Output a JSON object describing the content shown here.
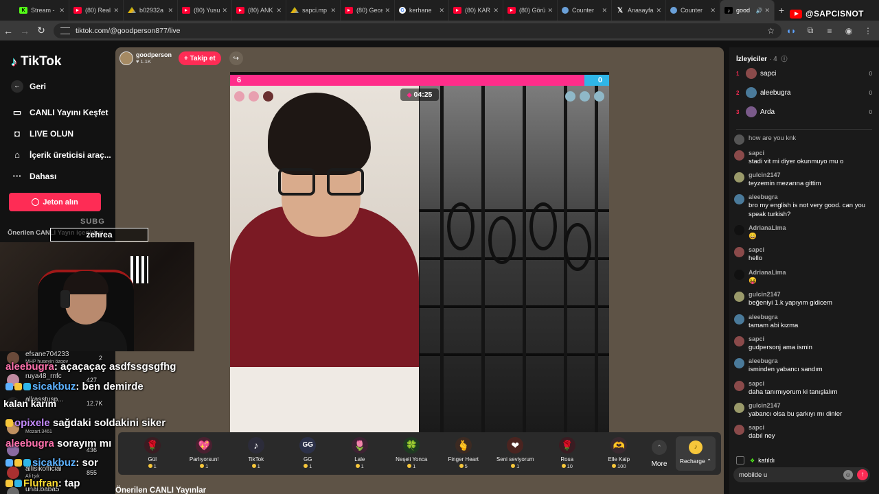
{
  "browser": {
    "tabs": [
      {
        "label": "Stream -",
        "icon": "kick"
      },
      {
        "label": "(80) Real",
        "icon": "youtube"
      },
      {
        "label": "b02932a",
        "icon": "drive"
      },
      {
        "label": "(80) Yusu",
        "icon": "youtube"
      },
      {
        "label": "(80) ANK",
        "icon": "youtube"
      },
      {
        "label": "sapci.mp",
        "icon": "drive"
      },
      {
        "label": "(80) Gece",
        "icon": "youtube"
      },
      {
        "label": "kerhane",
        "icon": "google"
      },
      {
        "label": "(80) KAR",
        "icon": "youtube"
      },
      {
        "label": "(80) Görü",
        "icon": "youtube"
      },
      {
        "label": "Counter",
        "icon": "counter"
      },
      {
        "label": "Anasayfa",
        "icon": "x"
      },
      {
        "label": "Counter",
        "icon": "counter"
      },
      {
        "label": "good",
        "icon": "tiktok",
        "active": true
      }
    ],
    "url": "tiktok.com/@goodperson877/live"
  },
  "watermark": "@SAPCISNOT",
  "sidebar": {
    "logo": "TikTok",
    "back": "Geri",
    "discover": "CANLI Yayını Keşfet",
    "go_live": "LIVE OLUN",
    "creator_tools": "İçerik üreticisi araç...",
    "more": "Dahası",
    "coins": "Jeton alın",
    "suggested": "Önerilen CANLI Yayın içerikleri"
  },
  "stream": {
    "host_name": "goodperson",
    "host_likes": "1.1K",
    "follow_label": "+ Takip et",
    "score_left": "6",
    "score_right": "0",
    "timer": "04:25",
    "gifts": [
      {
        "name": "Gül",
        "price": "1",
        "icon": "🌹",
        "color": "#3a1c22"
      },
      {
        "name": "Parlıyorsun!",
        "price": "1",
        "icon": "💖",
        "color": "#4a2030"
      },
      {
        "name": "TikTok",
        "price": "1",
        "icon": "♪",
        "color": "#2c2c3a"
      },
      {
        "name": "GG",
        "price": "1",
        "icon": "GG",
        "color": "#2c3148"
      },
      {
        "name": "Lale",
        "price": "1",
        "icon": "🌷",
        "color": "#3e2233"
      },
      {
        "name": "Neşeli Yonca",
        "price": "1",
        "icon": "🍀",
        "color": "#1f3a22"
      },
      {
        "name": "Finger Heart",
        "price": "5",
        "icon": "🫰",
        "color": "#3c2a22"
      },
      {
        "name": "Seni seviyorum",
        "price": "1",
        "icon": "❤",
        "color": "#4a2420"
      },
      {
        "name": "Rosa",
        "price": "10",
        "icon": "🌹",
        "color": "#3a1c22"
      },
      {
        "name": "Elle Kalp",
        "price": "100",
        "icon": "🫶",
        "color": "#3a2a30"
      }
    ],
    "more_label": "More",
    "recharge_label": "Recharge"
  },
  "chat": {
    "viewers_label": "İzleyiciler",
    "viewers_count": "· 4",
    "viewers": [
      {
        "rank": "1",
        "name": "sapci",
        "score": "0",
        "color": "#8a4a4a"
      },
      {
        "rank": "2",
        "name": "aleebugra",
        "score": "0",
        "color": "#4a7a9a"
      },
      {
        "rank": "3",
        "name": "Arda",
        "score": "0",
        "color": "#7a5a8a"
      }
    ],
    "messages": [
      {
        "user": "",
        "text": "how are you knk",
        "color": "#555"
      },
      {
        "user": "sapci",
        "text": "stadi vit mi diyer okunmuyo mu o",
        "color": "#8a4a4a"
      },
      {
        "user": "gulcin2147",
        "text": "teyzemin mezarına gittim",
        "color": "#9a9a6a"
      },
      {
        "user": "aleebugra",
        "text": "bro my english is not very good. can you speak turkish?",
        "color": "#4a7a9a"
      },
      {
        "user": "AdrianaLima",
        "text": "😄",
        "color": "#111"
      },
      {
        "user": "sapci",
        "text": "hello",
        "color": "#8a4a4a"
      },
      {
        "user": "AdrianaLima",
        "text": "😝",
        "color": "#111"
      },
      {
        "user": "gulcin2147",
        "text": "beğeniyi 1.k yapıyım gidicem",
        "color": "#9a9a6a"
      },
      {
        "user": "aleebugra",
        "text": "tamam abi kızma",
        "color": "#4a7a9a"
      },
      {
        "user": "sapci",
        "text": "gudpersonj ama ismin",
        "color": "#8a4a4a"
      },
      {
        "user": "aleebugra",
        "text": "isminden yabancı sandım",
        "color": "#4a7a9a"
      },
      {
        "user": "sapci",
        "text": "daha tanımıyorum ki tanışlalım",
        "color": "#8a4a4a"
      },
      {
        "user": "gulcin2147",
        "text": "yabancı olsa bu şarkıyı mı dinler",
        "color": "#9a9a6a"
      },
      {
        "user": "sapci",
        "text": "dabıl ney",
        "color": "#8a4a4a"
      }
    ],
    "joined_text": "katıldı",
    "input_value": "mobilde u"
  },
  "overlay": {
    "sub_title": "SUBG",
    "sub_name": "zehrea",
    "leaderboard": [
      {
        "name": "efsane704233",
        "sub": "MHP huseyin özgov",
        "count": "2"
      },
      {
        "name": "ruya48_rnfc",
        "sub": "",
        "count": "427"
      },
      {
        "name": "alkasstusp...",
        "sub": "",
        "count": "12.7K"
      },
      {
        "name": "",
        "sub": "Mozart.3461",
        "count": ""
      },
      {
        "name": "",
        "sub": "",
        "count": "436"
      },
      {
        "name": "allisikofficial",
        "sub": "Ali Işık",
        "count": "855"
      },
      {
        "name": "unal.baba5",
        "sub": "",
        "count": ""
      }
    ],
    "chat_lines": [
      {
        "user": "aleebugra",
        "text": ": açaçaçaç asdfssgsgfhg"
      },
      {
        "user": "sicakbuz",
        "text": ": ben demirde"
      },
      {
        "user": "",
        "text": "kalan karım"
      },
      {
        "user": "opixele",
        "text": " sağdaki soldakini siker"
      },
      {
        "user": "aleebugra",
        "text": " sorayım mı"
      },
      {
        "user": "sicakbuz",
        "text": ": sor"
      },
      {
        "user": "Flufran",
        "text": ": tap"
      }
    ]
  },
  "recommended_label": "Önerilen CANLI Yayınlar"
}
